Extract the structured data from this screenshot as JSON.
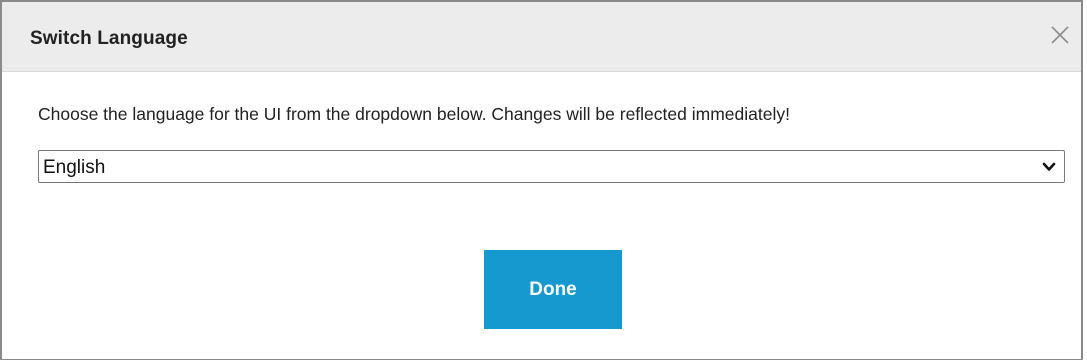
{
  "dialog": {
    "title": "Switch Language",
    "instruction": "Choose the language for the UI from the dropdown below. Changes will be reflected immediately!",
    "language_select": {
      "selected": "English"
    },
    "done_label": "Done",
    "colors": {
      "header_bg": "#ececec",
      "button_bg": "#1599cf",
      "button_text": "#ffffff"
    },
    "icons": {
      "close": "close-icon",
      "dropdown": "chevron-down-icon"
    }
  }
}
